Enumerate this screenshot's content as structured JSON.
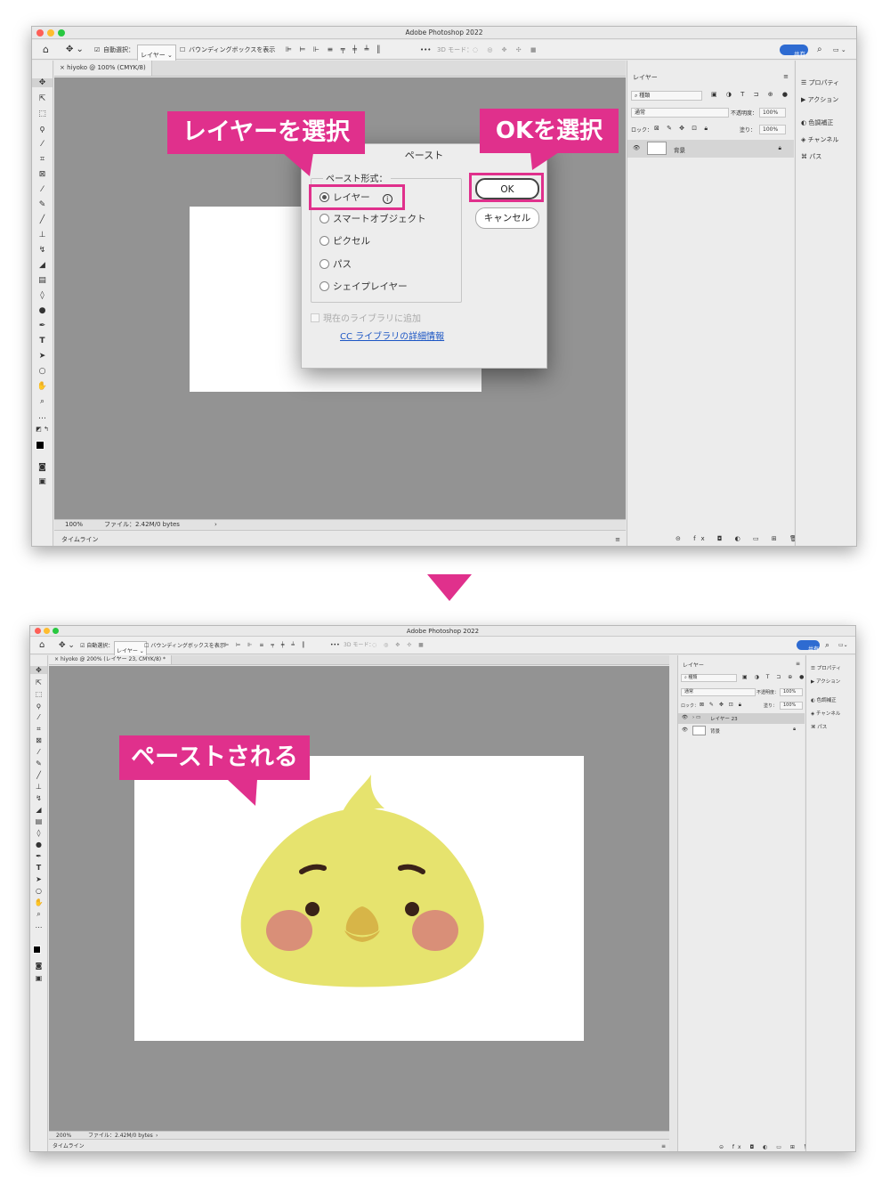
{
  "app": {
    "title": "Adobe Photoshop 2022",
    "share_label": "共有"
  },
  "options_bar": {
    "auto_select_label": "自動選択：",
    "auto_select_value": "レイヤー",
    "bounding_box_label": "バウンディングボックスを表示",
    "more": "•••",
    "mode_3d": "3D モード："
  },
  "top": {
    "doc_tab": "hiyoko @ 100% (CMYK/8)",
    "zoom": "100%",
    "file_info": "ファイル：2.42M/0 bytes",
    "timeline": "タイムライン",
    "layers_tab": "レイヤー",
    "search_kind": "種類",
    "blend_mode": "通常",
    "opacity_label": "不透明度：",
    "opacity_value": "100%",
    "lock_label": "ロック：",
    "fill_label": "塗り：",
    "fill_value": "100%",
    "layers": [
      {
        "name": "背景"
      }
    ]
  },
  "right_panels": {
    "properties": "プロパティ",
    "actions": "アクション",
    "adjustments": "色調補正",
    "channels": "チャンネル",
    "paths": "パス"
  },
  "dialog": {
    "title": "ペースト",
    "group_label": "ペースト形式：",
    "options": [
      "レイヤー",
      "スマートオブジェクト",
      "ピクセル",
      "パス",
      "シェイプレイヤー"
    ],
    "selected": "レイヤー",
    "add_to_library": "現在のライブラリに追加",
    "library_link": "CC ライブラリの詳細情報",
    "ok_label": "OK",
    "cancel_label": "キャンセル"
  },
  "callouts": {
    "select_layer": "レイヤーを選択",
    "select_ok": "OKを選択",
    "pasted": "ペーストされる"
  },
  "bottom": {
    "doc_tab": "hiyoko @ 200% (レイヤー 23, CMYK/8) *",
    "zoom": "200%",
    "file_info": "ファイル：2.42M/0 bytes",
    "timeline": "タイムライン",
    "layers_tab": "レイヤー",
    "search_kind": "種類",
    "blend_mode": "通常",
    "opacity_label": "不透明度：",
    "opacity_value": "100%",
    "lock_label": "ロック：",
    "fill_label": "塗り：",
    "fill_value": "100%",
    "layers": [
      {
        "name": "レイヤー 23"
      },
      {
        "name": "背景"
      }
    ]
  },
  "colors": {
    "accent": "#e0308c",
    "canvas_bg": "#939393",
    "chick": "#e6e36e",
    "cheek": "#d98f78",
    "beak": "#d7b548",
    "share": "#2e6bd1"
  },
  "icons": [
    "home-icon",
    "move-icon",
    "marquee-icon",
    "lasso-icon",
    "crop-icon",
    "eyedropper-icon",
    "brush-icon",
    "stamp-icon",
    "eraser-icon",
    "gradient-icon",
    "pen-icon",
    "text-icon",
    "hand-icon",
    "zoom-icon",
    "search-icon",
    "eye-icon",
    "lock-icon",
    "info-icon",
    "arrow-down-icon"
  ]
}
